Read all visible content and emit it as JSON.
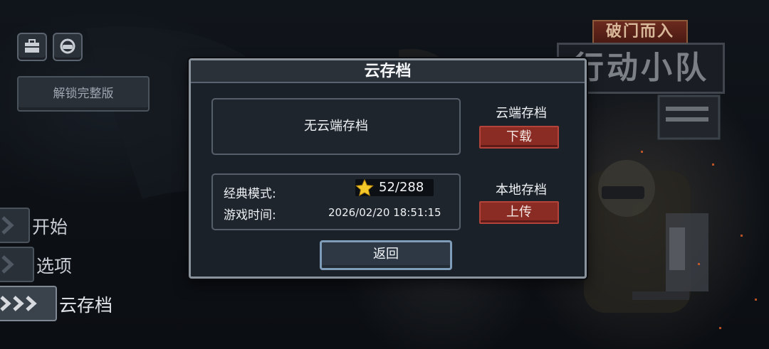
{
  "logo": {
    "subtitle": "破门而入",
    "title": "行动小队"
  },
  "left_panel": {
    "unlock_label": "解锁完整版",
    "menu": [
      {
        "label": "开始"
      },
      {
        "label": "选项"
      },
      {
        "label": "云存档"
      }
    ]
  },
  "dialog": {
    "title": "云存档",
    "cloud_status": "无云端存档",
    "cloud_save_label": "云端存档",
    "download_label": "下载",
    "local_save_label": "本地存档",
    "upload_label": "上传",
    "classic_mode_label": "经典模式:",
    "stars_value": "52/288",
    "playtime_label": "游戏时间:",
    "playtime_value": "2026/02/20  18:51:15",
    "back_label": "返回"
  },
  "icons": [
    "briefcase-icon",
    "gamepad-icon",
    "chevron-icon",
    "star-icon"
  ],
  "colors": {
    "accent_red": "#8a2b24",
    "dialog_border": "#8a939c",
    "back_border": "#7f9cb8"
  }
}
